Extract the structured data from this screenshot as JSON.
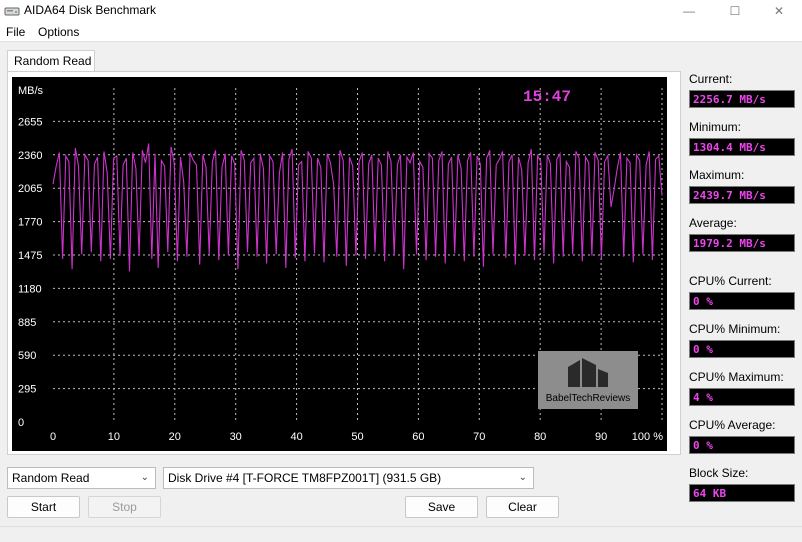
{
  "window": {
    "title": "AIDA64 Disk Benchmark",
    "minimize": "—",
    "maximize": "☐",
    "close": "✕"
  },
  "menu": {
    "file": "File",
    "options": "Options"
  },
  "tab": {
    "label": "Random Read"
  },
  "chart_data": {
    "type": "line",
    "title": "",
    "time": "15:47",
    "ylabel": "MB/s",
    "xlabel": "",
    "y_ticks": [
      0,
      295,
      590,
      885,
      1180,
      1475,
      1770,
      2065,
      2360,
      2655
    ],
    "x_ticks": [
      "0",
      "10",
      "20",
      "30",
      "40",
      "50",
      "60",
      "70",
      "80",
      "90",
      "100 %"
    ],
    "xlim": [
      0,
      100
    ],
    "ylim": [
      0,
      2950
    ],
    "grid": true,
    "line_color": "#cc33cc",
    "watermark": "BabelTechReviews",
    "series": [
      {
        "values": [
          2100,
          2260,
          2380,
          1440,
          2350,
          2300,
          1350,
          2420,
          2260,
          1480,
          2360,
          2310,
          1500,
          2280,
          2340,
          1420,
          2390,
          2200,
          1440,
          2330,
          2350,
          1470,
          2270,
          2330,
          1330,
          2380,
          2240,
          1470,
          2400,
          2290,
          2460,
          1440,
          2370,
          1360,
          2310,
          2260,
          1500,
          2430,
          2290,
          1420,
          2340,
          2120,
          1460,
          2380,
          2310,
          2270,
          1390,
          2360,
          2250,
          1480,
          2300,
          2400,
          1430,
          2250,
          2370,
          1470,
          2350,
          2280,
          1350,
          2400,
          2310,
          1500,
          2290,
          2330,
          1460,
          2370,
          2240,
          1400,
          2350,
          2300,
          1480,
          2200,
          2380,
          1360,
          2320,
          2410,
          1450,
          2270,
          2300,
          1420,
          2390,
          2330,
          1490,
          2330,
          2250,
          1410,
          2370,
          2290,
          2100,
          1460,
          2400,
          2310,
          1380,
          2340,
          2260,
          1470,
          2300,
          2380,
          1440,
          2280,
          2360,
          1500,
          2330,
          2270,
          1420,
          2390,
          2300,
          1470,
          2270,
          2360,
          1350,
          2340,
          2290,
          2380,
          1480,
          2300,
          2250,
          1430,
          2370,
          2330,
          1460,
          2310,
          2390,
          1400,
          2280,
          2340,
          1490,
          2360,
          2240,
          1420,
          2310,
          2380,
          1460,
          2350,
          2280,
          1370,
          2330,
          2400,
          1480,
          2270,
          2320,
          2390,
          1450,
          2300,
          2360,
          1390,
          2340,
          2230,
          1470,
          2290,
          2410,
          1430,
          2350,
          2300,
          1490,
          2360,
          2280,
          1400,
          2320,
          2370,
          1460,
          2300,
          2250,
          1480,
          2390,
          2330,
          1420,
          2340,
          2290,
          1470,
          2380,
          2310,
          1440,
          2300,
          2350,
          1900,
          2060,
          2250,
          2380,
          1460,
          2330,
          2290,
          1410,
          2360,
          2310,
          1480,
          2270,
          2390,
          1430,
          2320,
          2350,
          2000
        ]
      }
    ]
  },
  "bottom": {
    "test_select": "Random Read",
    "drive_select": "Disk Drive #4  [T-FORCE TM8FPZ001T]  (931.5 GB)",
    "start": "Start",
    "stop": "Stop",
    "save": "Save",
    "clear": "Clear"
  },
  "stats": {
    "current_label": "Current:",
    "current": "2256.7 MB/s",
    "minimum_label": "Minimum:",
    "minimum": "1304.4 MB/s",
    "maximum_label": "Maximum:",
    "maximum": "2439.7 MB/s",
    "average_label": "Average:",
    "average": "1979.2 MB/s",
    "cpu_current_label": "CPU% Current:",
    "cpu_current": "0 %",
    "cpu_minimum_label": "CPU% Minimum:",
    "cpu_minimum": "0 %",
    "cpu_maximum_label": "CPU% Maximum:",
    "cpu_maximum": "4 %",
    "cpu_average_label": "CPU% Average:",
    "cpu_average": "0 %",
    "block_size_label": "Block Size:",
    "block_size": "64 KB"
  }
}
